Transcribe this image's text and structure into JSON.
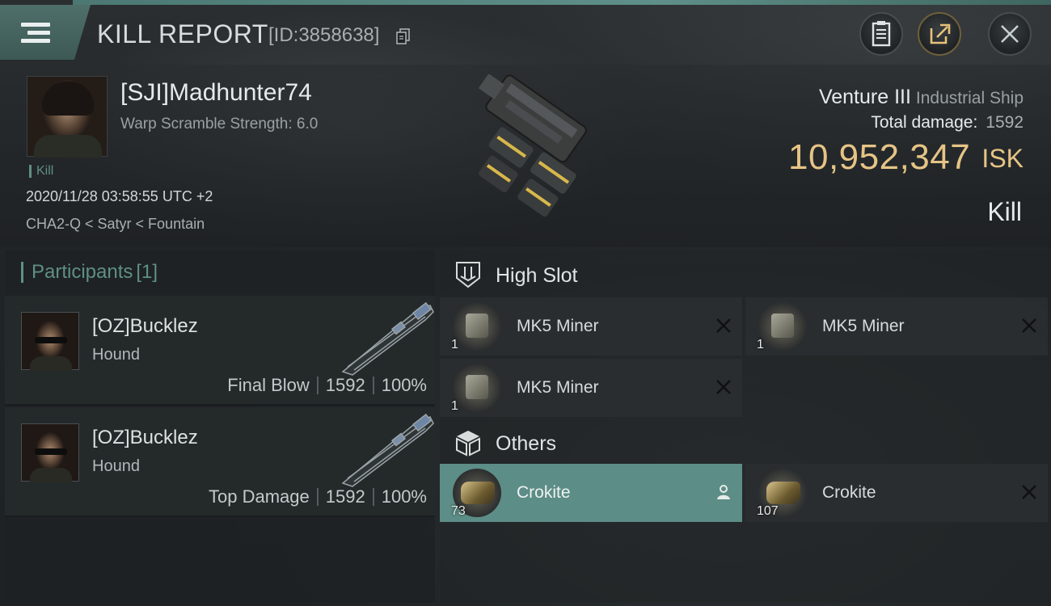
{
  "header": {
    "title": "KILL REPORT",
    "report_id": "[ID:3858638]"
  },
  "victim": {
    "name": "[SJI]Madhunter74",
    "warp_scramble": "Warp Scramble Strength: 6.0",
    "kill_tag": "Kill",
    "date": "2020/11/28 03:58:55 UTC +2",
    "location": "CHA2-Q < Satyr < Fountain",
    "ship_name": "Venture III",
    "ship_class": "Industrial Ship",
    "total_damage_label": "Total damage:",
    "total_damage_value": "1592",
    "isk_value": "10,952,347",
    "isk_unit": "ISK",
    "result": "Kill"
  },
  "participants": {
    "title": "Participants",
    "count": "[1]",
    "rows": [
      {
        "name": "[OZ]Bucklez",
        "ship": "Hound",
        "role": "Final Blow",
        "damage": "1592",
        "percent": "100%"
      },
      {
        "name": "[OZ]Bucklez",
        "ship": "Hound",
        "role": "Top Damage",
        "damage": "1592",
        "percent": "100%"
      }
    ]
  },
  "items": {
    "high_slot": {
      "label": "High Slot",
      "list": [
        {
          "name": "MK5 Miner",
          "qty": "1",
          "status": "destroyed"
        },
        {
          "name": "MK5 Miner",
          "qty": "1",
          "status": "destroyed"
        },
        {
          "name": "MK5 Miner",
          "qty": "1",
          "status": "destroyed"
        }
      ]
    },
    "others": {
      "label": "Others",
      "list": [
        {
          "name": "Crokite",
          "qty": "73",
          "status": "dropped"
        },
        {
          "name": "Crokite",
          "qty": "107",
          "status": "destroyed"
        }
      ]
    }
  },
  "colors": {
    "accent": "#5f8f86",
    "isk": "#e6c486",
    "selected_item": "#5c8d86"
  }
}
